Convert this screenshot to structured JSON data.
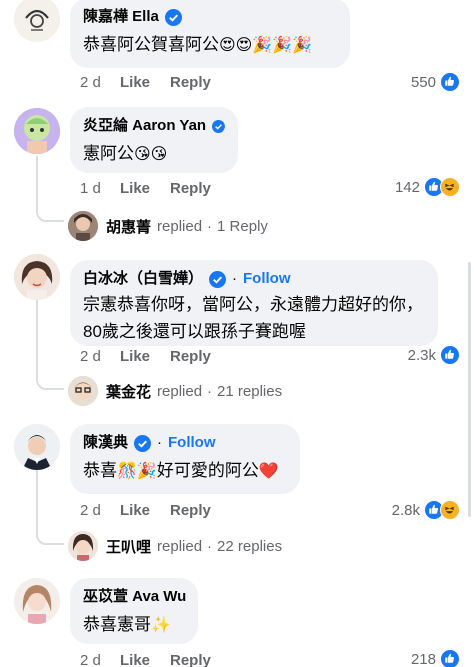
{
  "comments": [
    {
      "name": "陳嘉樺 Ella",
      "verified": true,
      "text": "恭喜阿公賀喜阿公",
      "emojis": "😍😍🎉🎉🎉",
      "time": "2 d",
      "like_label": "Like",
      "reply_label": "Reply",
      "reaction_count": "550",
      "reactions": []
    },
    {
      "name": "炎亞綸 Aaron Yan",
      "verified": true,
      "text": "憲阿公",
      "emojis": "😘😘",
      "time": "1 d",
      "like_label": "Like",
      "reply_label": "Reply",
      "reaction_count": "142",
      "reactions": [
        "like",
        "haha"
      ],
      "reply_summary": {
        "name": "胡惠菁",
        "label": "replied",
        "sep": "·",
        "count": "1 Reply"
      }
    },
    {
      "name": "白冰冰（白雪嬅）",
      "verified": true,
      "follow": "Follow",
      "text_line1": "宗憲恭喜你呀，當阿公，永遠體力超好的你，",
      "text_line2": "80歲之後還可以跟孫子賽跑喔",
      "time": "2 d",
      "like_label": "Like",
      "reply_label": "Reply",
      "reaction_count": "2.3k",
      "reactions": [
        "like"
      ],
      "reply_summary": {
        "name": "葉金花",
        "label": "replied",
        "sep": "·",
        "count": "21 replies"
      }
    },
    {
      "name": "陳漢典",
      "verified": true,
      "follow": "Follow",
      "text_pre": "恭喜",
      "emojis_mid": "🎊🎉",
      "text_post": "好可愛的阿公",
      "emojis_end": "❤️",
      "time": "2 d",
      "like_label": "Like",
      "reply_label": "Reply",
      "reaction_count": "2.8k",
      "reactions": [
        "like",
        "haha"
      ],
      "reply_summary": {
        "name": "王叭哩",
        "label": "replied",
        "sep": "·",
        "count": "22 replies"
      }
    },
    {
      "name": "巫苡萱 Ava Wu",
      "verified": false,
      "text": "恭喜憲哥",
      "emojis": "✨",
      "time": "2 d",
      "like_label": "Like",
      "reply_label": "Reply",
      "reaction_count": "218",
      "reactions": [
        "like"
      ]
    }
  ],
  "colors": {
    "bubble": "#f0f2f5",
    "link": "#1877f2",
    "secondary": "#65676b",
    "like": "#1877f2",
    "haha": "#f7b125"
  }
}
